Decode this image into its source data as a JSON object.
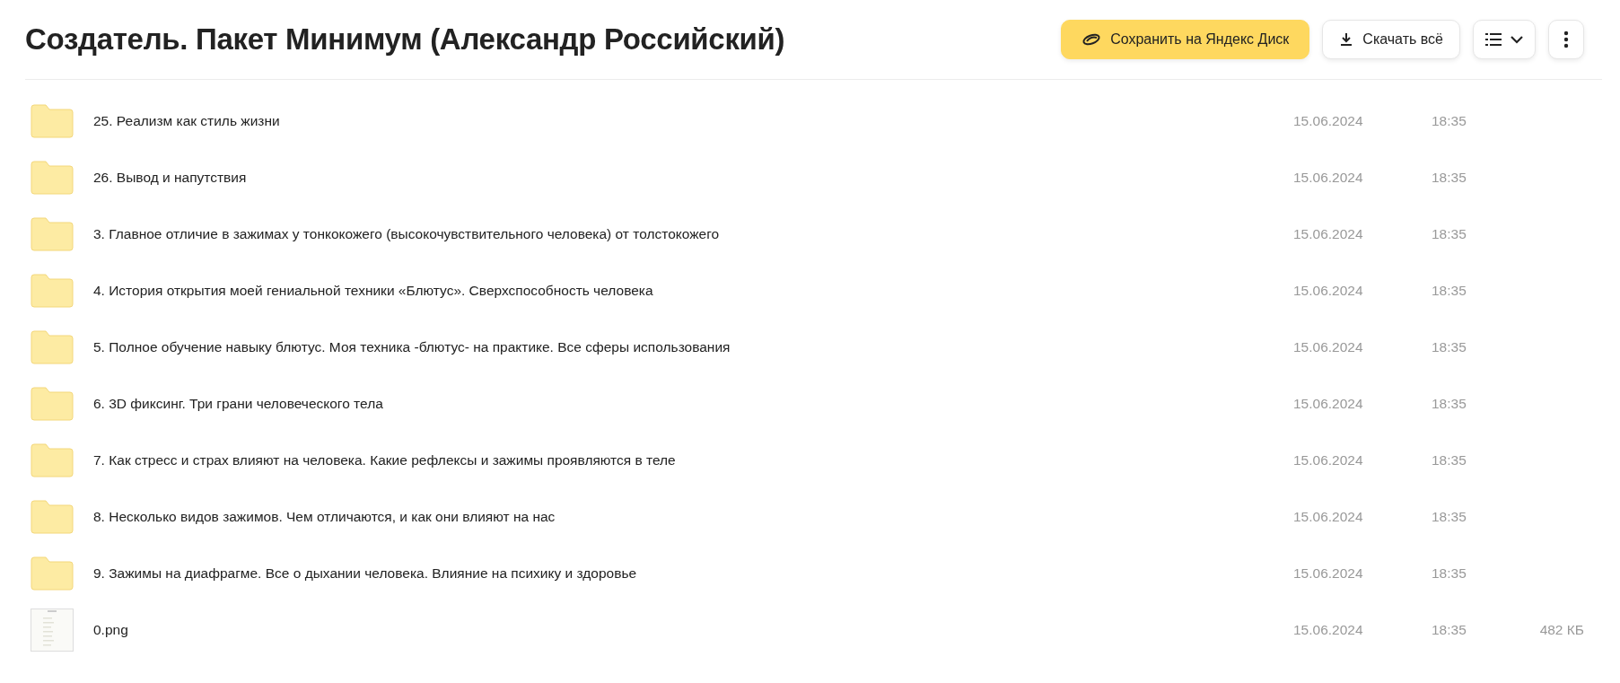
{
  "title": "Создатель. Пакет Минимум (Александр Российский)",
  "actions": [
    {
      "kind": "save",
      "label": "Сохранить на Яндекс Диск"
    },
    {
      "kind": "download",
      "label": "Скачать всё"
    },
    {
      "kind": "view"
    },
    {
      "kind": "more"
    }
  ],
  "items": [
    {
      "kind": "folder",
      "name": "25. Реализм как стиль жизни",
      "date": "15.06.2024",
      "time": "18:35"
    },
    {
      "kind": "folder",
      "name": "26. Вывод и напутствия",
      "date": "15.06.2024",
      "time": "18:35"
    },
    {
      "kind": "folder",
      "name": "3. Главное отличие в зажимах у тонкокожего (высокочувствительного человека) от толстокожего",
      "date": "15.06.2024",
      "time": "18:35"
    },
    {
      "kind": "folder",
      "name": "4. История открытия моей гениальной техники «Блютус». Сверхспособность человека",
      "date": "15.06.2024",
      "time": "18:35"
    },
    {
      "kind": "folder",
      "name": "5. Полное обучение навыку блютус. Моя техника -блютус- на практике. Все сферы использования",
      "date": "15.06.2024",
      "time": "18:35"
    },
    {
      "kind": "folder",
      "name": "6. 3D фиксинг. Три грани человеческого тела",
      "date": "15.06.2024",
      "time": "18:35"
    },
    {
      "kind": "folder",
      "name": "7. Как стресс и страх влияют на человека. Какие рефлексы и зажимы проявляются в теле",
      "date": "15.06.2024",
      "time": "18:35"
    },
    {
      "kind": "folder",
      "name": "8. Несколько видов зажимов. Чем отличаются, и как они влияют на нас",
      "date": "15.06.2024",
      "time": "18:35"
    },
    {
      "kind": "folder",
      "name": "9. Зажимы на диафрагме. Все о дыхании человека. Влияние на психику и здоровье",
      "date": "15.06.2024",
      "time": "18:35"
    },
    {
      "name": "0.png",
      "date": "15.06.2024",
      "time": "18:35",
      "size": "482 КБ"
    }
  ]
}
